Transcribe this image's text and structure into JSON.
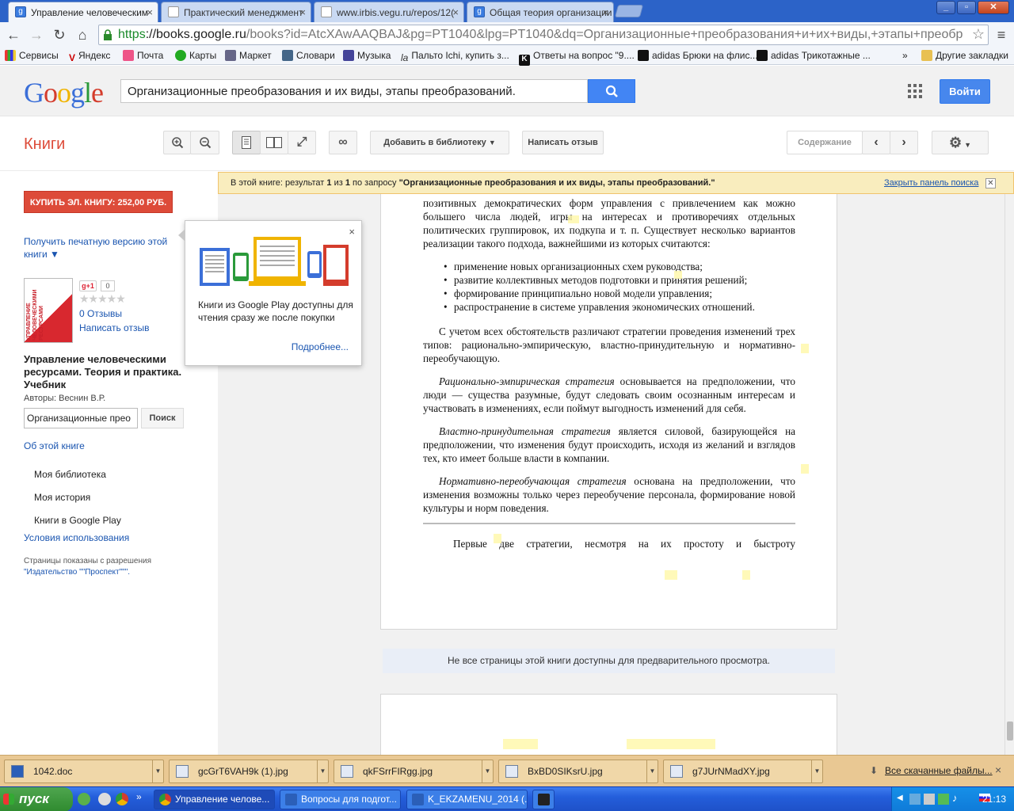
{
  "browser": {
    "tabs": [
      {
        "title": "Управление человеческим"
      },
      {
        "title": "Практический менеджмент"
      },
      {
        "title": "www.irbis.vegu.ru/repos/12("
      },
      {
        "title": "Общая теория организации"
      }
    ],
    "url_scheme": "https",
    "url_host": "://books.google.ru",
    "url_rest": "/books?id=AtcXAwAAQBAJ&pg=PT1040&lpg=PT1040&dq=Организационные+преобразования+и+их+виды,+этапы+преобр",
    "bookmarks": [
      "Сервисы",
      "Яндекс",
      "Почта",
      "Карты",
      "Маркет",
      "Словари",
      "Музыка",
      "Пальто Ichi, купить з...",
      "Ответы на вопрос \"9....",
      "adidas Брюки на флис...",
      "adidas Трикотажные ...",
      "»",
      "Другие закладки"
    ]
  },
  "google": {
    "logo": "Google",
    "search_value": "Организационные преобразования и их виды, этапы преобразований.",
    "signin_label": "Войти"
  },
  "books_toolbar": {
    "title": "Книги",
    "add_library": "Добавить в библиотеку",
    "write_review": "Написать отзыв",
    "contents": "Содержание"
  },
  "notice": {
    "prefix": "В этой книге: результат",
    "n1": "1",
    "of": "из",
    "n2": "1",
    "by_query": "по запросу",
    "query": "\"Организационные преобразования и их виды, этапы преобразований.\"",
    "close_label": "Закрыть панель поиска"
  },
  "left": {
    "buy_label": "КУПИТЬ ЭЛ. КНИГУ: 252,00 РУБ.",
    "print_version": "Получить печатную версию этой книги ▼",
    "gplus": "g+1",
    "gplus_count": "0",
    "reviews": "0 Отзывы",
    "write_review": "Написать отзыв",
    "book_title": "Управление человеческими ресурсами. Теория и практика. Учебник",
    "authors": "Авторы: Веснин В.Р.",
    "search_value": "Организационные прео",
    "search_btn": "Поиск",
    "about": "Об этой книге",
    "my_library": "Моя библиотека",
    "my_history": "Моя история",
    "play_books": "Книги в Google Play",
    "terms": "Условия использования",
    "pages_shown": "Страницы показаны с разрешения",
    "publisher": "\"Издательство \"\"Проспект\"\"\".",
    "cover_title": "УПРАВЛЕНИЕ ЧЕЛОВЕЧЕСКИМИ РЕСУРСАМИ"
  },
  "popup": {
    "text": "Книги из Google Play доступны для чтения сразу же после покупки",
    "more": "Подробнее..."
  },
  "page": {
    "p0": "позитивных демократических форм управления с привлечением как можно большего числа людей, игры на интересах и противоречиях отдельных политических группировок, их подкупа и т. п. Существует несколько вариантов реализации такого подхода, важнейшими из которых считаются:",
    "bullets": [
      "применение новых организационных схем руководства;",
      "развитие коллективных методов подготовки и принятия решений;",
      "формирование принципиально новой модели управления;",
      "распространение в системе управления экономических отношений."
    ],
    "p1": "С учетом всех обстоятельств различают стратегии проведения изменений трех типов: рационально-эмпирическую, властно-принудительную и нормативно-переобучающую.",
    "p2_em": "Рационально-эмпирическая стратегия",
    "p2": " основывается на предположении, что люди — существа разумные, будут следовать своим осознанным интересам и участвовать в изменениях, если поймут выгодность изменений для себя.",
    "p3_em": "Властно-принудительная стратегия",
    "p3": " является силовой, базирующейся на предположении, что изменения будут происходить, исходя из желаний и взглядов тех, кто имеет больше власти в компании.",
    "p4_em": "Нормативно-переобучающая стратегия",
    "p4": " основана на предположении, что изменения возможны только через переобучение персонала, формирование новой культуры и норм поведения.",
    "p5": "Первые две стратегии, несмотря на их простоту и быстроту",
    "unavailable": "Не все страницы этой книги доступны для предварительного просмотра."
  },
  "downloads": {
    "items": [
      "1042.doc",
      "gcGrT6VAH9k (1).jpg",
      "qkFSrrFIRgg.jpg",
      "BxBD0SIKsrU.jpg",
      "g7JUrNMadXY.jpg"
    ],
    "all": "Все скачанные файлы..."
  },
  "taskbar": {
    "start": "пуск",
    "tasks": [
      "Управление челове...",
      "Вопросы для подгот...",
      "K_EKZAMENU_2014 (..."
    ],
    "clock": "21:13"
  }
}
